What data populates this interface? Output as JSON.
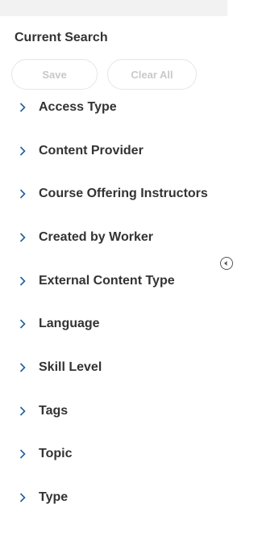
{
  "panel": {
    "title": "Current Search",
    "save_label": "Save",
    "clear_label": "Clear All"
  },
  "facets": [
    {
      "label": "Access Type"
    },
    {
      "label": "Content Provider"
    },
    {
      "label": "Course Offering Instructors"
    },
    {
      "label": "Created by Worker"
    },
    {
      "label": "External Content Type"
    },
    {
      "label": "Language"
    },
    {
      "label": "Skill Level"
    },
    {
      "label": "Tags"
    },
    {
      "label": "Topic"
    },
    {
      "label": "Type"
    }
  ],
  "icons": {
    "facet_expand": "chevron-right-icon",
    "panel_toggle": "collapse-arrow-icon"
  },
  "colors": {
    "text": "#333333",
    "chevron": "#1f5f9e",
    "disabled_text": "#c9c9c9",
    "top_strip": "#f2f2f3"
  }
}
